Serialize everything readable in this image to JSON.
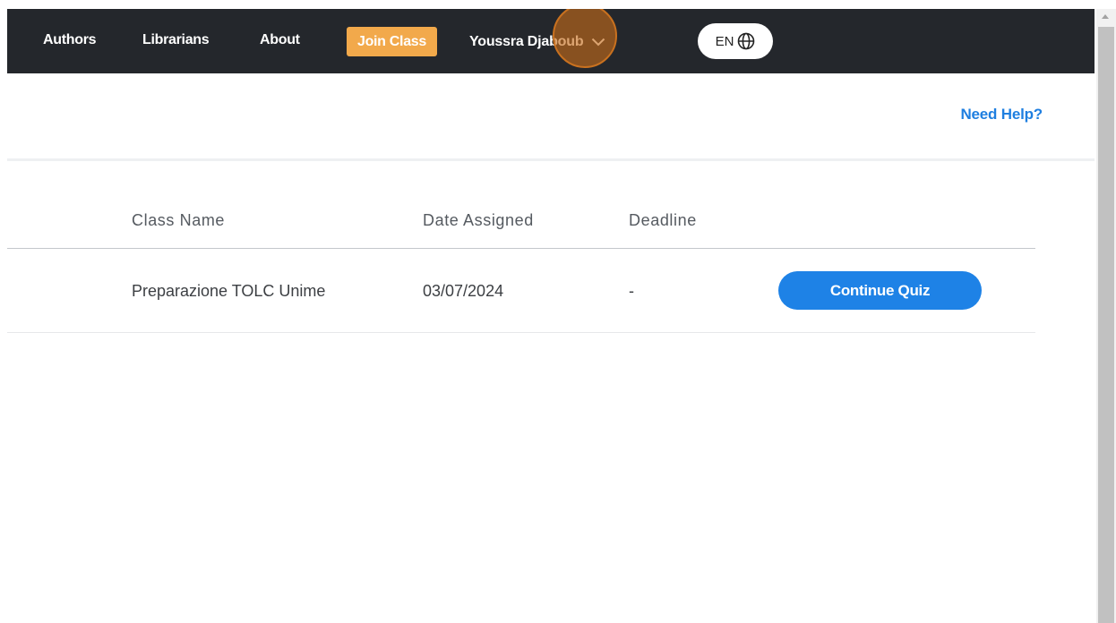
{
  "nav": {
    "authors": "Authors",
    "librarians": "Librarians",
    "about": "About",
    "join_class": "Join Class",
    "user_name": "Youssra Djaboub",
    "language": "EN"
  },
  "subheader": {
    "help": "Need Help?"
  },
  "table": {
    "headers": [
      "Class Name",
      "Date Assigned",
      "Deadline"
    ],
    "rows": [
      {
        "class_name": "Preparazione TOLC Unime",
        "date_assigned": "03/07/2024",
        "deadline": "-",
        "action": "Continue Quiz"
      }
    ]
  },
  "colors": {
    "topbar": "#24272c",
    "join_button": "#f2a94b",
    "accent_blue": "#1e82e6",
    "help_link": "#1f7fe0"
  },
  "icons": {
    "user_dropdown": "chevron-down-icon",
    "language": "globe-icon"
  }
}
